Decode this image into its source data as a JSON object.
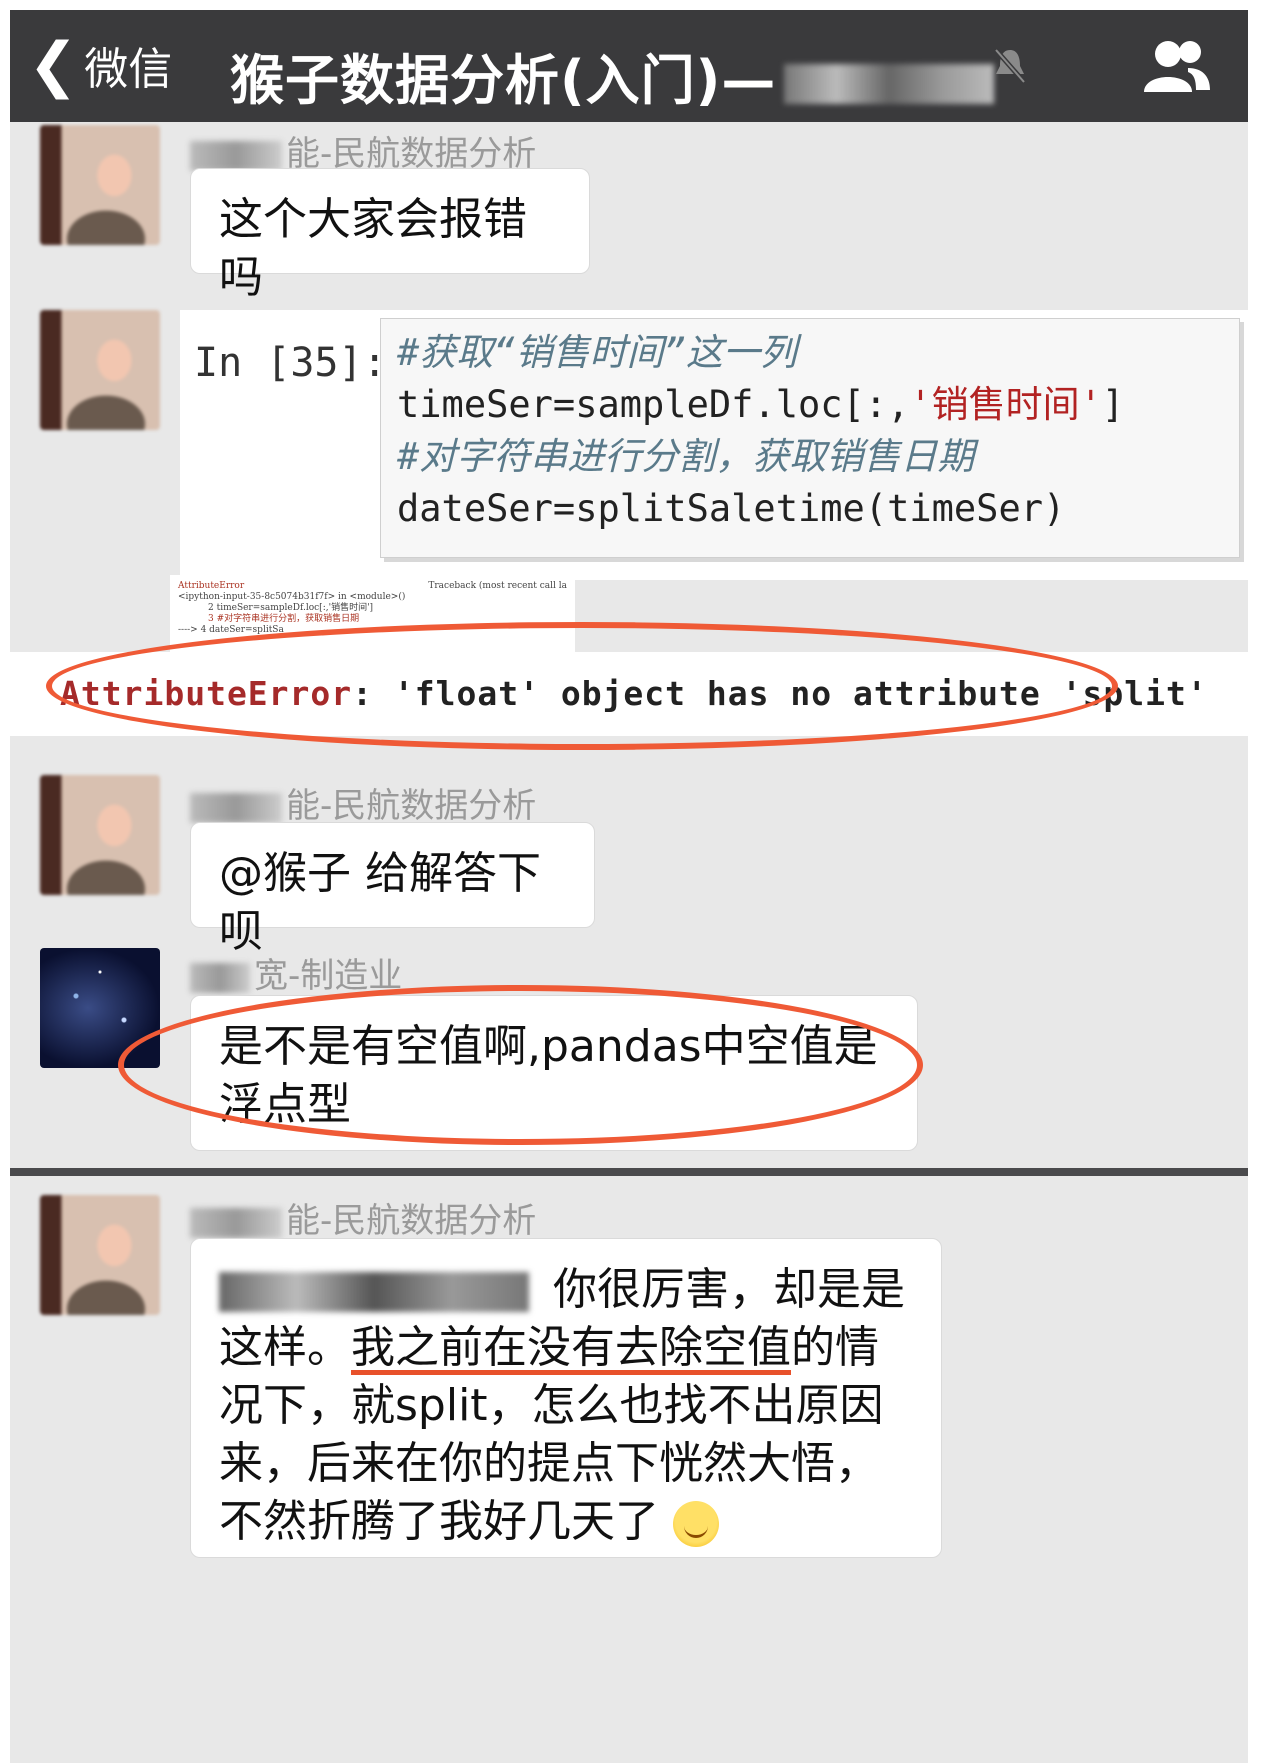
{
  "header": {
    "back_label": "微信",
    "title": "猴子数据分析(入门)—",
    "icons": [
      "chevron-left-icon",
      "mute-icon",
      "group-icon"
    ]
  },
  "messages": [
    {
      "sender_suffix": "能-民航数据分析",
      "text": "这个大家会报错吗"
    },
    {
      "sender_suffix": "能-民航数据分析"
    },
    {
      "sender_suffix": "能-民航数据分析",
      "text": "@猴子 给解答下呗"
    },
    {
      "sender_suffix": "宽-制造业",
      "text": "是不是有空值啊,pandas中空值是浮点型"
    },
    {
      "sender_suffix": "能-民航数据分析",
      "text_a": " 你很厉害，却是是这样。",
      "text_underlined": "我之前在没有去除空值",
      "text_b": "的情况下，就split，怎么也找不出原因来，后来在你的提点下恍然大悟，不然折腾了我好几天了"
    }
  ],
  "code": {
    "prompt": "In [35]:",
    "line1": "#获取“销售时间”这一列",
    "line2_pre": "timeSer=sampleDf.loc[:,",
    "line2_str": "'销售时间'",
    "line2_post": "]",
    "line3": "#对字符串进行分割，获取销售日期",
    "line4": "dateSer=splitSaletime(timeSer)"
  },
  "traceback": {
    "head": "AttributeError",
    "right": "Traceback (most recent call la",
    "line1": "<ipython-input-35-8c5074b31f7f> in <module>()",
    "line2": "2 timeSer=sampleDf.loc[:,'销售时间']",
    "line3": "3 #对字符串进行分割，获取销售日期",
    "line4": "----> 4 dateSer=splitSa"
  },
  "error": {
    "head": "AttributeError",
    "message": ": 'float' object has no attribute 'split'"
  },
  "colors": {
    "header": "#3a3a3c",
    "highlight": "#ef5a36",
    "chat_bg": "#e8e8e8"
  }
}
